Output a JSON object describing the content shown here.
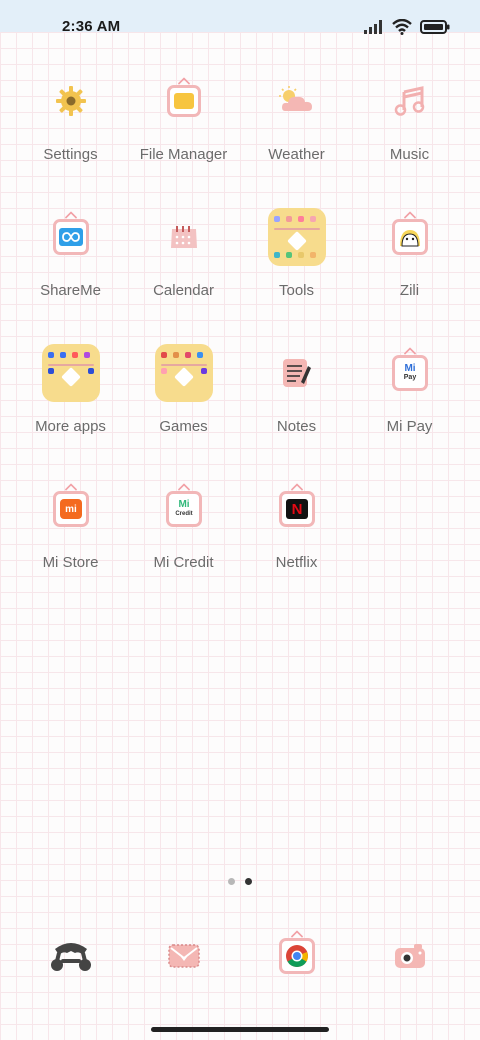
{
  "status": {
    "time": "2:36 AM"
  },
  "apps": [
    {
      "label": "Settings",
      "icon": "gear-icon"
    },
    {
      "label": "File Manager",
      "icon": "folder-icon"
    },
    {
      "label": "Weather",
      "icon": "weather-icon"
    },
    {
      "label": "Music",
      "icon": "music-icon"
    },
    {
      "label": "ShareMe",
      "icon": "shareme-icon"
    },
    {
      "label": "Calendar",
      "icon": "calendar-icon"
    },
    {
      "label": "Tools",
      "icon": "folder-tools-icon"
    },
    {
      "label": "Zili",
      "icon": "zili-icon"
    },
    {
      "label": "More apps",
      "icon": "folder-more-apps-icon"
    },
    {
      "label": "Games",
      "icon": "folder-games-icon"
    },
    {
      "label": "Notes",
      "icon": "notes-icon"
    },
    {
      "label": "Mi Pay",
      "icon": "mipay-icon",
      "badge": "Pay"
    },
    {
      "label": "Mi Store",
      "icon": "mistore-icon",
      "badge": "mi"
    },
    {
      "label": "Mi Credit",
      "icon": "micredit-icon",
      "badge": "Credit"
    },
    {
      "label": "Netflix",
      "icon": "netflix-icon",
      "badge": "N"
    }
  ],
  "dock": [
    {
      "icon": "phone-icon"
    },
    {
      "icon": "messages-icon"
    },
    {
      "icon": "chrome-icon"
    },
    {
      "icon": "camera-icon"
    }
  ],
  "pages": {
    "count": 2,
    "current": 2
  },
  "colors": {
    "pink": "#f2b7b8",
    "folder": "#f7dc8d",
    "status_bar": "#e3eff9"
  }
}
